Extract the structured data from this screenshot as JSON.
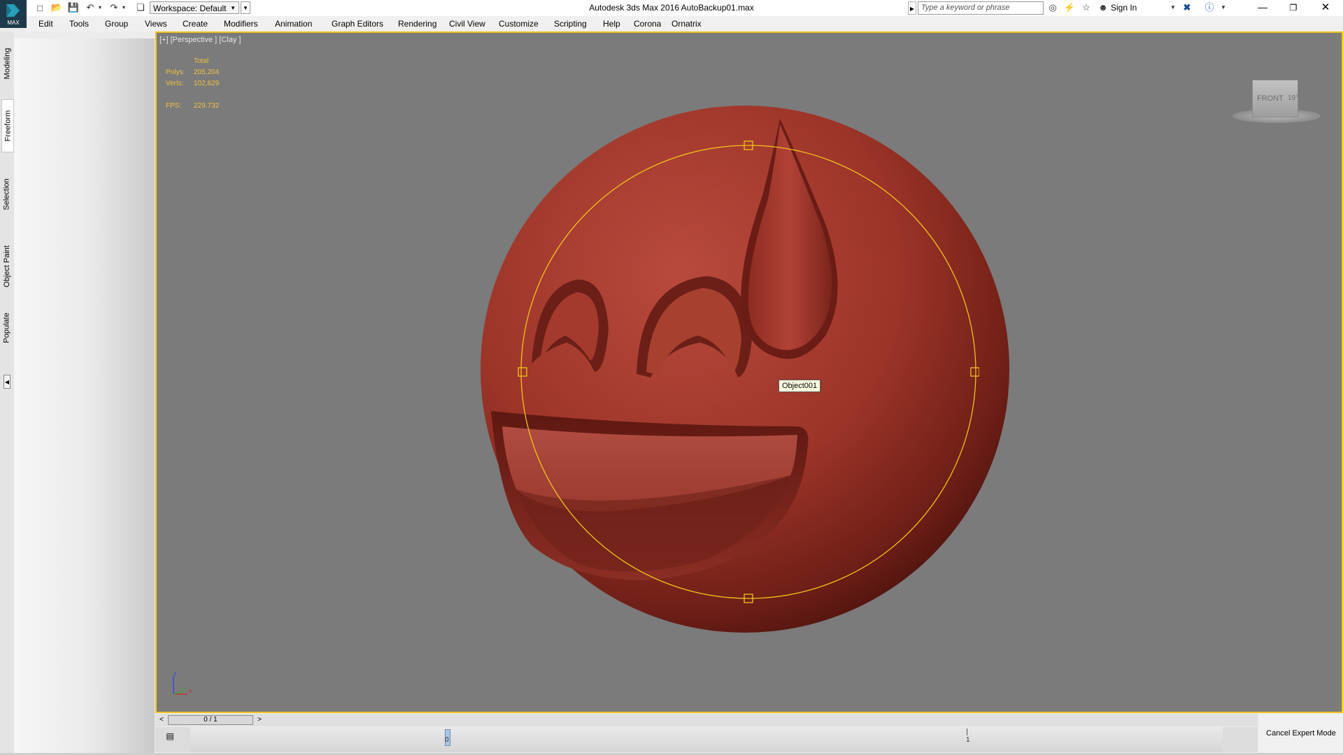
{
  "app": {
    "logo_text": "MAX",
    "title": "Autodesk 3ds Max 2016    AutoBackup01.max",
    "workspace_label": "Workspace: Default"
  },
  "search": {
    "placeholder": "Type a keyword or phrase"
  },
  "account": {
    "sign_in_label": "Sign In"
  },
  "menu": [
    "Edit",
    "Tools",
    "Group",
    "Views",
    "Create",
    "Modifiers",
    "Animation",
    "Graph Editors",
    "Rendering",
    "Civil View",
    "Customize",
    "Scripting",
    "Help",
    "Corona",
    "Ornatrix"
  ],
  "ribbon_tabs": [
    {
      "label": "Modeling",
      "active": false
    },
    {
      "label": "Freeform",
      "active": true
    },
    {
      "label": "Selection",
      "active": false
    },
    {
      "label": "Object Paint",
      "active": false
    },
    {
      "label": "Populate",
      "active": false
    }
  ],
  "viewport": {
    "label": "[+] [Perspective ] [Clay ]",
    "stats": {
      "header": "Total",
      "polys_label": "Polys:",
      "polys_value": "205,204",
      "verts_label": "Verts:",
      "verts_value": "102,629",
      "fps_label": "FPS:",
      "fps_value": "229.732"
    },
    "object_tooltip": "Object001",
    "viewcube_label": "FRONT",
    "viewcube_side": "19°",
    "axis_labels": {
      "z": "z",
      "y": "y",
      "x": "x"
    },
    "border_color": "#f2c21b",
    "background_color": "#7b7b7b",
    "model_color": "#a83a2e"
  },
  "timeline": {
    "frame_display": "0 / 1",
    "prev_label": "<",
    "next_label": ">",
    "start_frame": "0",
    "end_frame": "1"
  },
  "status": {
    "cancel_expert_label": "Cancel Expert Mode"
  }
}
